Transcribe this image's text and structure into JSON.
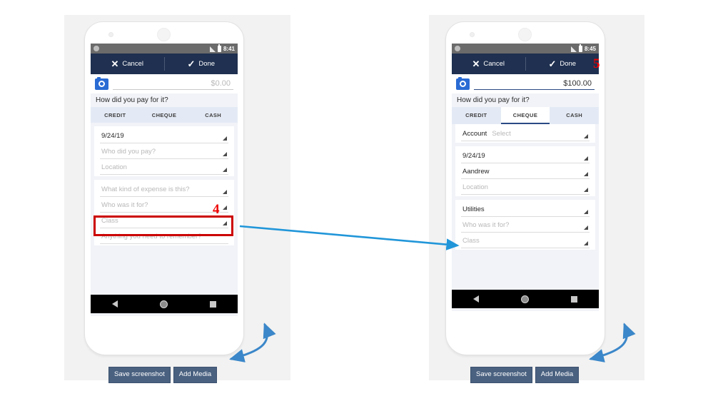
{
  "page": {
    "background": "#ffffff",
    "panel_color": "#f2f2f2"
  },
  "annotations": {
    "step4": {
      "number": "4",
      "color": "#ee0000",
      "target": "expense-type-field"
    },
    "step5": {
      "number": "5",
      "color": "#ee0000",
      "target": "toolbar-done"
    },
    "arrow_color": "#2196d9",
    "highlight_box_color": "#cc0000"
  },
  "phones": [
    {
      "id": "left",
      "statusbar": {
        "time": "8:41",
        "icons": [
          "signal-icon",
          "battery-icon"
        ]
      },
      "toolbar": {
        "cancel_label": "Cancel",
        "cancel_icon": "close-icon",
        "done_label": "Done",
        "done_icon": "check-icon",
        "background": "#1f3050"
      },
      "amount": {
        "camera_icon": "camera-icon",
        "value": "$0.00",
        "filled": false
      },
      "question": "How did you pay for it?",
      "tabs": [
        {
          "label": "CREDIT",
          "active": false
        },
        {
          "label": "CHEQUE",
          "active": false
        },
        {
          "label": "CASH",
          "active": false
        }
      ],
      "account_row": null,
      "fields_card_one": [
        {
          "text": "9/24/19",
          "filled": true
        },
        {
          "text": "Who did you pay?",
          "filled": false
        },
        {
          "text": "Location",
          "filled": false
        }
      ],
      "fields_card_two": [
        {
          "text": "What kind of expense is this?",
          "filled": false,
          "highlighted": true
        },
        {
          "text": "Who was it for?",
          "filled": false
        },
        {
          "text": "Class",
          "filled": false
        },
        {
          "text": "Anything you need to remember?",
          "filled": false
        }
      ],
      "navbar": [
        "back-icon",
        "home-icon",
        "recents-icon"
      ],
      "buttons": [
        {
          "label": "Save screenshot"
        },
        {
          "label": "Add Media"
        }
      ]
    },
    {
      "id": "right",
      "statusbar": {
        "time": "8:45",
        "icons": [
          "signal-icon",
          "battery-icon"
        ]
      },
      "toolbar": {
        "cancel_label": "Cancel",
        "cancel_icon": "close-icon",
        "done_label": "Done",
        "done_icon": "check-icon",
        "background": "#1f3050"
      },
      "amount": {
        "camera_icon": "camera-icon",
        "value": "$100.00",
        "filled": true
      },
      "question": "How did you pay for it?",
      "tabs": [
        {
          "label": "CREDIT",
          "active": false
        },
        {
          "label": "CHEQUE",
          "active": true
        },
        {
          "label": "CASH",
          "active": false
        }
      ],
      "account_row": {
        "label": "Account",
        "value": "Select",
        "filled": false
      },
      "fields_card_one": [
        {
          "text": "9/24/19",
          "filled": true
        },
        {
          "text": "Aandrew",
          "filled": true
        },
        {
          "text": "Location",
          "filled": false
        }
      ],
      "fields_card_two": [
        {
          "text": "Utilities",
          "filled": true,
          "highlighted": false
        },
        {
          "text": "Who was it for?",
          "filled": false
        },
        {
          "text": "Class",
          "filled": false
        }
      ],
      "navbar": [
        "back-icon",
        "home-icon",
        "recents-icon"
      ],
      "buttons": [
        {
          "label": "Save screenshot"
        },
        {
          "label": "Add Media"
        }
      ]
    }
  ]
}
